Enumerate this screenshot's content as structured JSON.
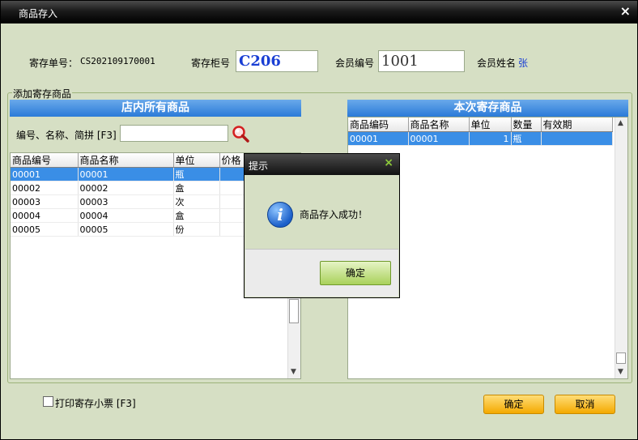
{
  "window": {
    "title": "商品存入",
    "close_glyph": "×"
  },
  "header": {
    "ticket_label": "寄存单号：",
    "ticket_value": "CS202109170001",
    "cabinet_label": "寄存柜号",
    "cabinet_value": "C206",
    "member_no_label": "会员编号",
    "member_no_value": "1001",
    "member_name_label": "会员姓名",
    "member_name_value": "张"
  },
  "group": {
    "title": "添加寄存商品"
  },
  "left_panel": {
    "title": "店内所有商品",
    "search_label": "编号、名称、简拼 [F3]",
    "search_value": "",
    "columns": [
      "商品编号",
      "商品名称",
      "单位",
      "价格"
    ],
    "rows": [
      [
        "00001",
        "00001",
        "瓶",
        ""
      ],
      [
        "00002",
        "00002",
        "盒",
        ""
      ],
      [
        "00003",
        "00003",
        "次",
        ""
      ],
      [
        "00004",
        "00004",
        "盒",
        ""
      ],
      [
        "00005",
        "00005",
        "份",
        ""
      ]
    ]
  },
  "right_panel": {
    "title": "本次寄存商品",
    "columns": [
      "商品编码",
      "商品名称",
      "单位",
      "数量",
      "有效期"
    ],
    "rows": [
      [
        "00001",
        "00001",
        "1",
        "瓶",
        ""
      ]
    ]
  },
  "footer": {
    "print_label": "打印寄存小票 [F3]",
    "confirm_label": "确定",
    "cancel_label": "取消"
  },
  "dialog": {
    "title": "提示",
    "close_glyph": "×",
    "message": "商品存入成功！",
    "ok_label": "确定",
    "icon": "info-icon"
  }
}
